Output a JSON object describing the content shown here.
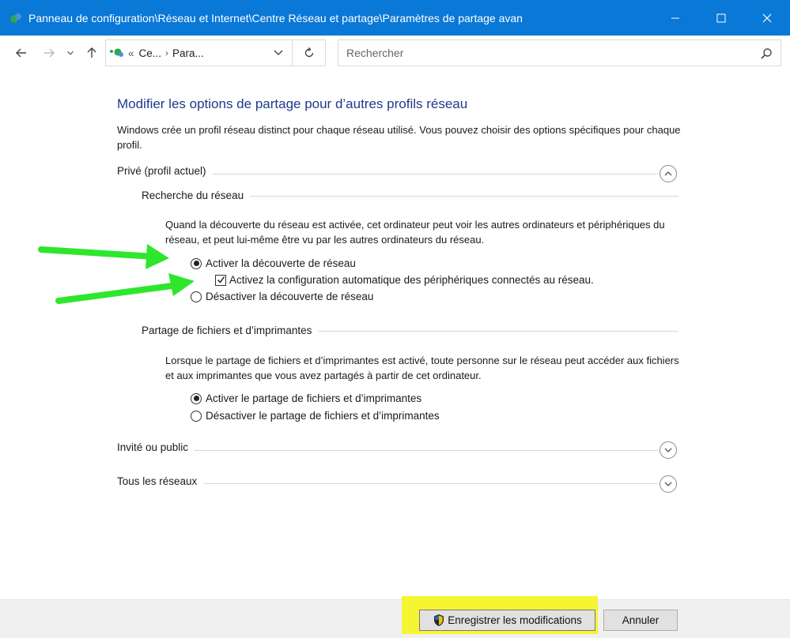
{
  "window": {
    "title": "Panneau de configuration\\Réseau et Internet\\Centre Réseau et partage\\Paramètres de partage avan",
    "colors": {
      "titlebar": "#0a78d7",
      "heading": "#1e3b8a",
      "highlight": "#f5f532",
      "arrow": "#2ee62e"
    }
  },
  "addressbar": {
    "crumb_prefix": "«",
    "crumb1": "Ce...",
    "crumb2": "Para...",
    "search_placeholder": "Rechercher"
  },
  "main": {
    "heading": "Modifier les options de partage pour d’autres profils réseau",
    "intro": "Windows crée un profil réseau distinct pour chaque réseau utilisé. Vous pouvez choisir des options spécifiques pour chaque profil.",
    "private_profile": {
      "label": "Privé (profil actuel)",
      "network_discovery": {
        "label": "Recherche du réseau",
        "description": "Quand la découverte du réseau est activée, cet ordinateur peut voir les autres ordinateurs et périphériques du réseau, et peut lui-même être vu par les autres ordinateurs du réseau.",
        "opt_on": "Activer la découverte de réseau",
        "opt_auto": "Activez la configuration automatique des périphériques connectés au réseau.",
        "opt_off": "Désactiver la découverte de réseau"
      },
      "file_sharing": {
        "label": "Partage de fichiers et d’imprimantes",
        "description": "Lorsque le partage de fichiers et d’imprimantes est activé, toute personne sur le réseau peut accéder aux fichiers et aux imprimantes que vous avez partagés à partir de cet ordinateur.",
        "opt_on": "Activer le partage de fichiers et d’imprimantes",
        "opt_off": "Désactiver le partage de fichiers et d’imprimantes"
      }
    },
    "guest_public": {
      "label": "Invité ou public"
    },
    "all_networks": {
      "label": "Tous les réseaux"
    }
  },
  "footer": {
    "save_label": "Enregistrer les modifications",
    "cancel_label": "Annuler"
  }
}
